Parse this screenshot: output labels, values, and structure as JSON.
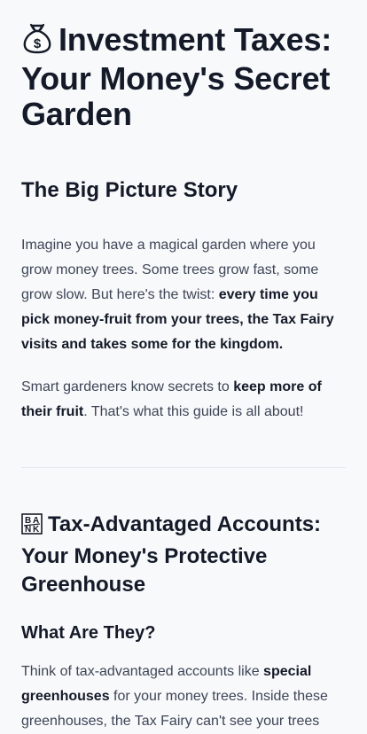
{
  "title": {
    "icon": "money-bag-icon",
    "text": "Investment Taxes: Your Money's Secret Garden"
  },
  "section1": {
    "heading": "The Big Picture Story",
    "p1_a": "Imagine you have a magical garden where you grow money trees. Some trees grow fast, some grow slow. But here's the twist: ",
    "p1_b": "every time you pick money-fruit from your trees, the Tax Fairy visits and takes some for the kingdom.",
    "p2_a": "Smart gardeners know secrets to ",
    "p2_b": "keep more of their fruit",
    "p2_c": ". That's what this guide is all about!"
  },
  "section2": {
    "icon": "bank-icon",
    "heading": "Tax-Advantaged Accounts: Your Money's Protective Greenhouse",
    "subheading": "What Are They?",
    "p_a": "Think of tax-advantaged accounts like ",
    "p_b": "special greenhouses",
    "p_c": " for your money trees. Inside these greenhouses, the Tax Fairy can't see your trees growing! She only visits when you take the money"
  }
}
